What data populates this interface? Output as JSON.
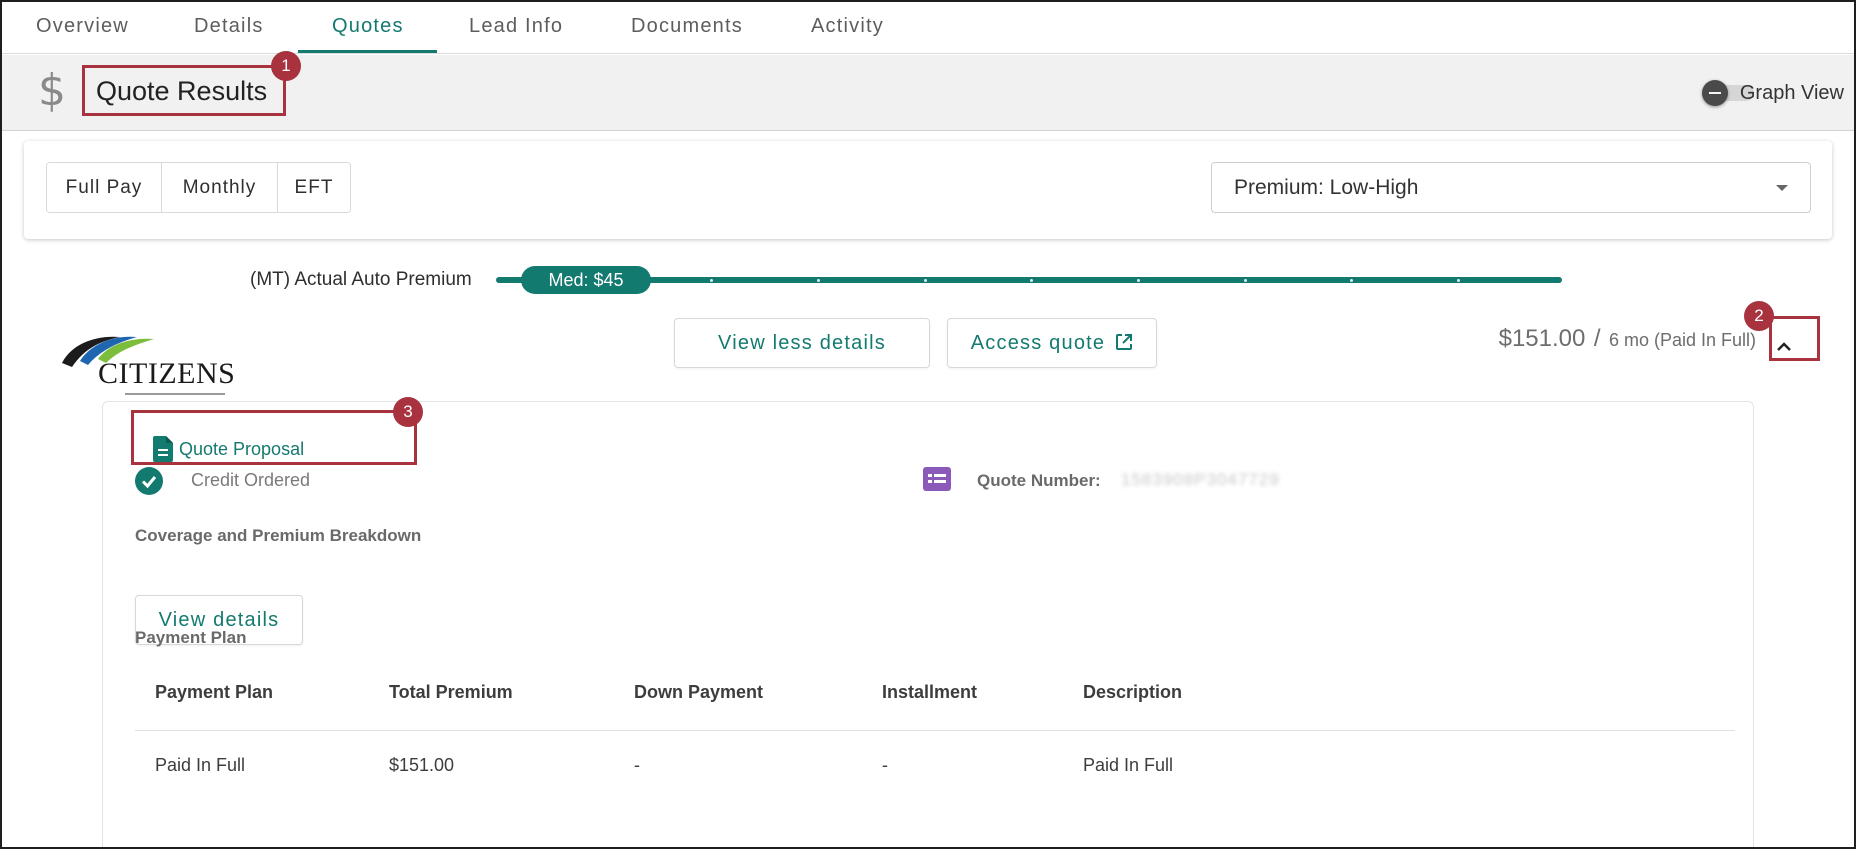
{
  "tabs": [
    {
      "label": "Overview",
      "active": false
    },
    {
      "label": "Details",
      "active": false
    },
    {
      "label": "Quotes",
      "active": true
    },
    {
      "label": "Lead Info",
      "active": false
    },
    {
      "label": "Documents",
      "active": false
    },
    {
      "label": "Activity",
      "active": false
    }
  ],
  "header": {
    "icon": "dollar-icon",
    "title": "Quote Results",
    "graph_toggle": {
      "label": "Graph View",
      "on": false
    }
  },
  "callouts": [
    "1",
    "2",
    "3"
  ],
  "colors": {
    "accent": "#137a6f",
    "callout": "#a8323e",
    "quote_number_icon": "#8b5ab8"
  },
  "filters": {
    "payment_types": [
      "Full Pay",
      "Monthly",
      "EFT"
    ],
    "sort": {
      "value": "Premium: Low-High"
    }
  },
  "premium_bar": {
    "label": "(MT) Actual Auto Premium",
    "median_label": "Med: $45"
  },
  "carrier": {
    "name": "CITIZENS",
    "view_less_label": "View less details",
    "access_quote_label": "Access quote",
    "price": "$151.00",
    "price_separator": "/",
    "term": "6 mo (Paid In Full)",
    "expanded": true,
    "details": {
      "quote_proposal_label": "Quote Proposal",
      "credit_status": "Credit Ordered",
      "quote_number_label": "Quote Number:",
      "quote_number_value": "1583908P3047729",
      "coverage_section_title": "Coverage and Premium Breakdown",
      "view_details_label": "View details",
      "payment_section_title": "Payment Plan",
      "payment_table": {
        "columns": [
          "Payment Plan",
          "Total Premium",
          "Down Payment",
          "Installment",
          "Description"
        ],
        "rows": [
          [
            "Paid In Full",
            "$151.00",
            "-",
            "-",
            "Paid In Full"
          ]
        ]
      }
    }
  }
}
